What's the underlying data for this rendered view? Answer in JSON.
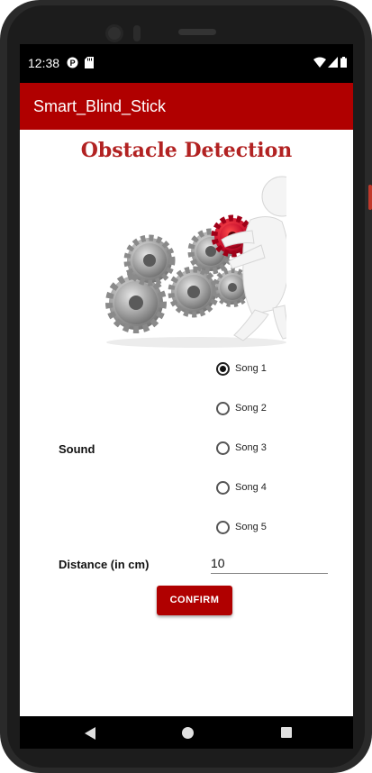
{
  "status_bar": {
    "time": "12:38"
  },
  "app_bar": {
    "title": "Smart_Blind_Stick"
  },
  "main": {
    "heading": "Obstacle Detection",
    "sound": {
      "label": "Sound",
      "options": [
        "Song 1",
        "Song 2",
        "Song 3",
        "Song 4",
        "Song 5"
      ],
      "selected": "Song 1"
    },
    "distance": {
      "label": "Distance (in cm)",
      "value": "10"
    },
    "confirm_label": "CONFIRM"
  },
  "colors": {
    "accent": "#b00000",
    "heading": "#b22222",
    "gear_red": "#c8102e",
    "gear_silver": "#a8a8a8"
  },
  "icons": [
    "data-saver-icon",
    "sd-card-icon",
    "wifi-icon",
    "signal-icon",
    "battery-icon",
    "back-icon",
    "home-icon",
    "recents-icon"
  ]
}
